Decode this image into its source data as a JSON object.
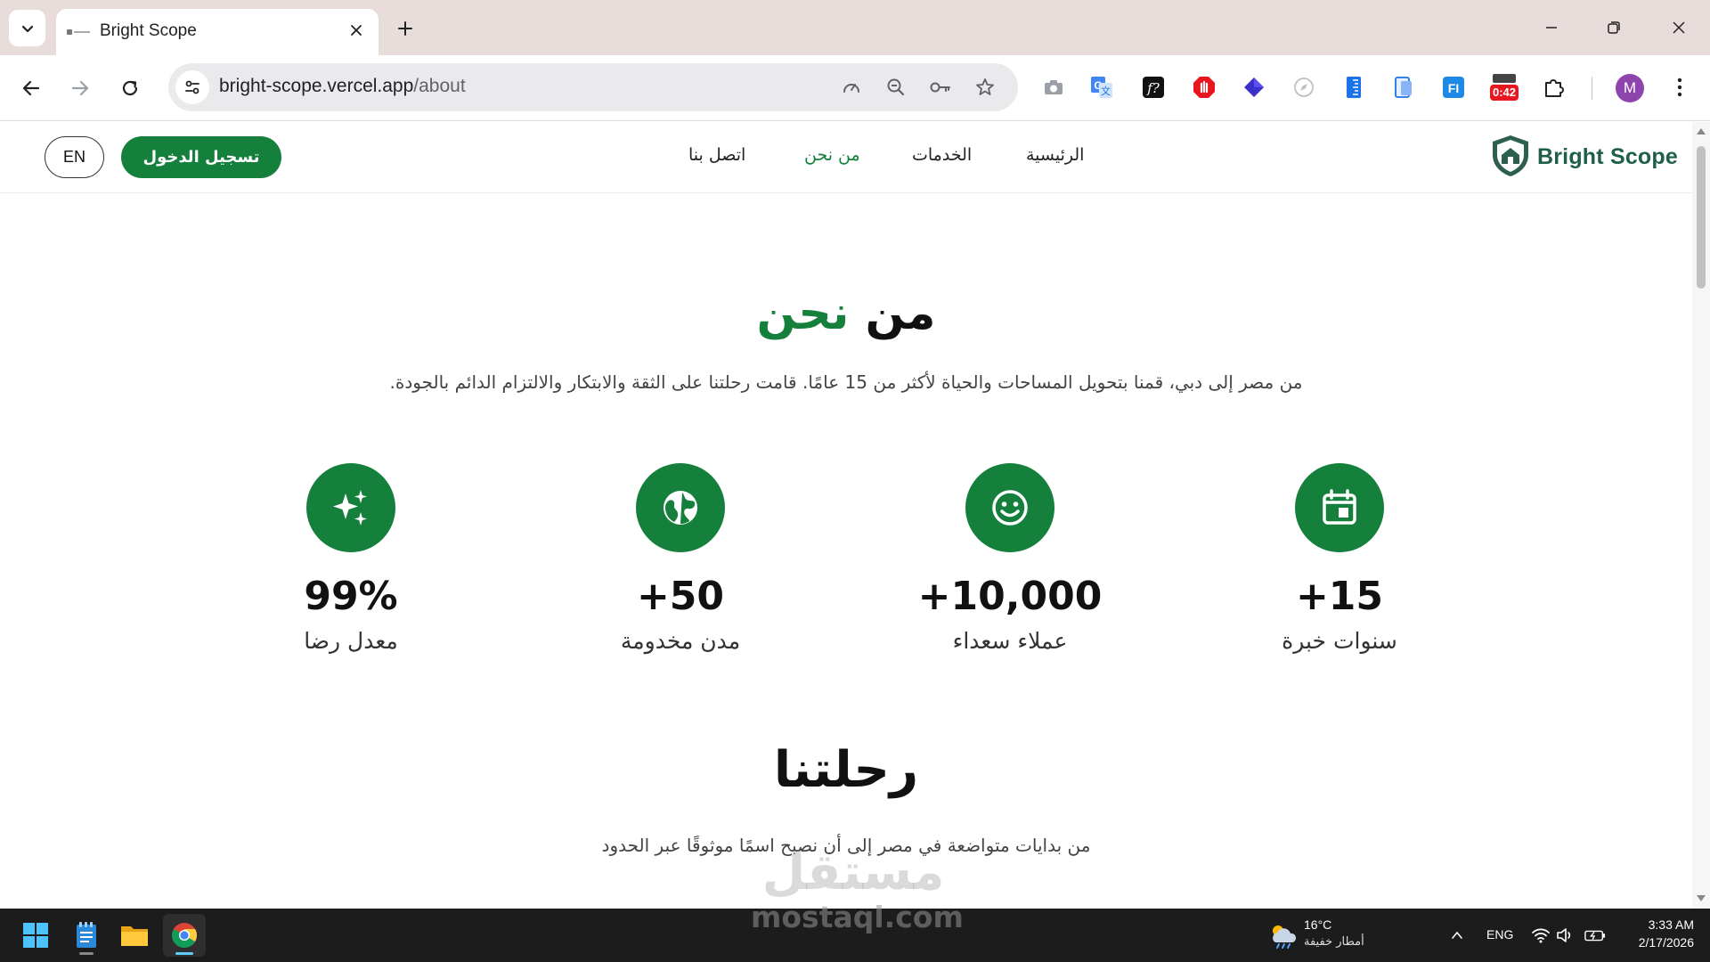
{
  "browser": {
    "tab_title": "Bright Scope",
    "url_domain": "bright-scope.vercel.app",
    "url_path": "/about",
    "recorder_badge": "0:42",
    "profile_initial": "M"
  },
  "site": {
    "logo_text": "Bright Scope",
    "nav": {
      "home": "الرئيسية",
      "services": "الخدمات",
      "about": "من نحن",
      "contact": "اتصل بنا"
    },
    "login_label": "تسجيل الدخول",
    "lang_label": "EN",
    "accent_color": "#14803c"
  },
  "hero": {
    "title_part1": "من",
    "title_part2": "نحن",
    "subtitle": "من مصر إلى دبي، قمنا بتحويل المساحات والحياة لأكثر من 15 عامًا. قامت رحلتنا على الثقة والابتكار والالتزام الدائم بالجودة."
  },
  "stats": [
    {
      "icon": "calendar-icon",
      "value": "+15",
      "label": "سنوات خبرة"
    },
    {
      "icon": "smile-icon",
      "value": "+10,000",
      "label": "عملاء سعداء"
    },
    {
      "icon": "globe-icon",
      "value": "+50",
      "label": "مدن مخدومة"
    },
    {
      "icon": "sparkles-icon",
      "value": "99%",
      "label": "معدل رضا"
    }
  ],
  "journey": {
    "title": "رحلتنا",
    "subtitle": "من بدايات متواضعة في مصر إلى أن نصبح اسمًا موثوقًا عبر الحدود"
  },
  "watermark": {
    "arabic": "مستقل",
    "latin": "mostaql.com"
  },
  "taskbar": {
    "weather_temp": "16°C",
    "weather_desc": "أمطار خفيفة",
    "language": "ENG",
    "time": "3:33 AM",
    "date": "2/17/2026"
  }
}
